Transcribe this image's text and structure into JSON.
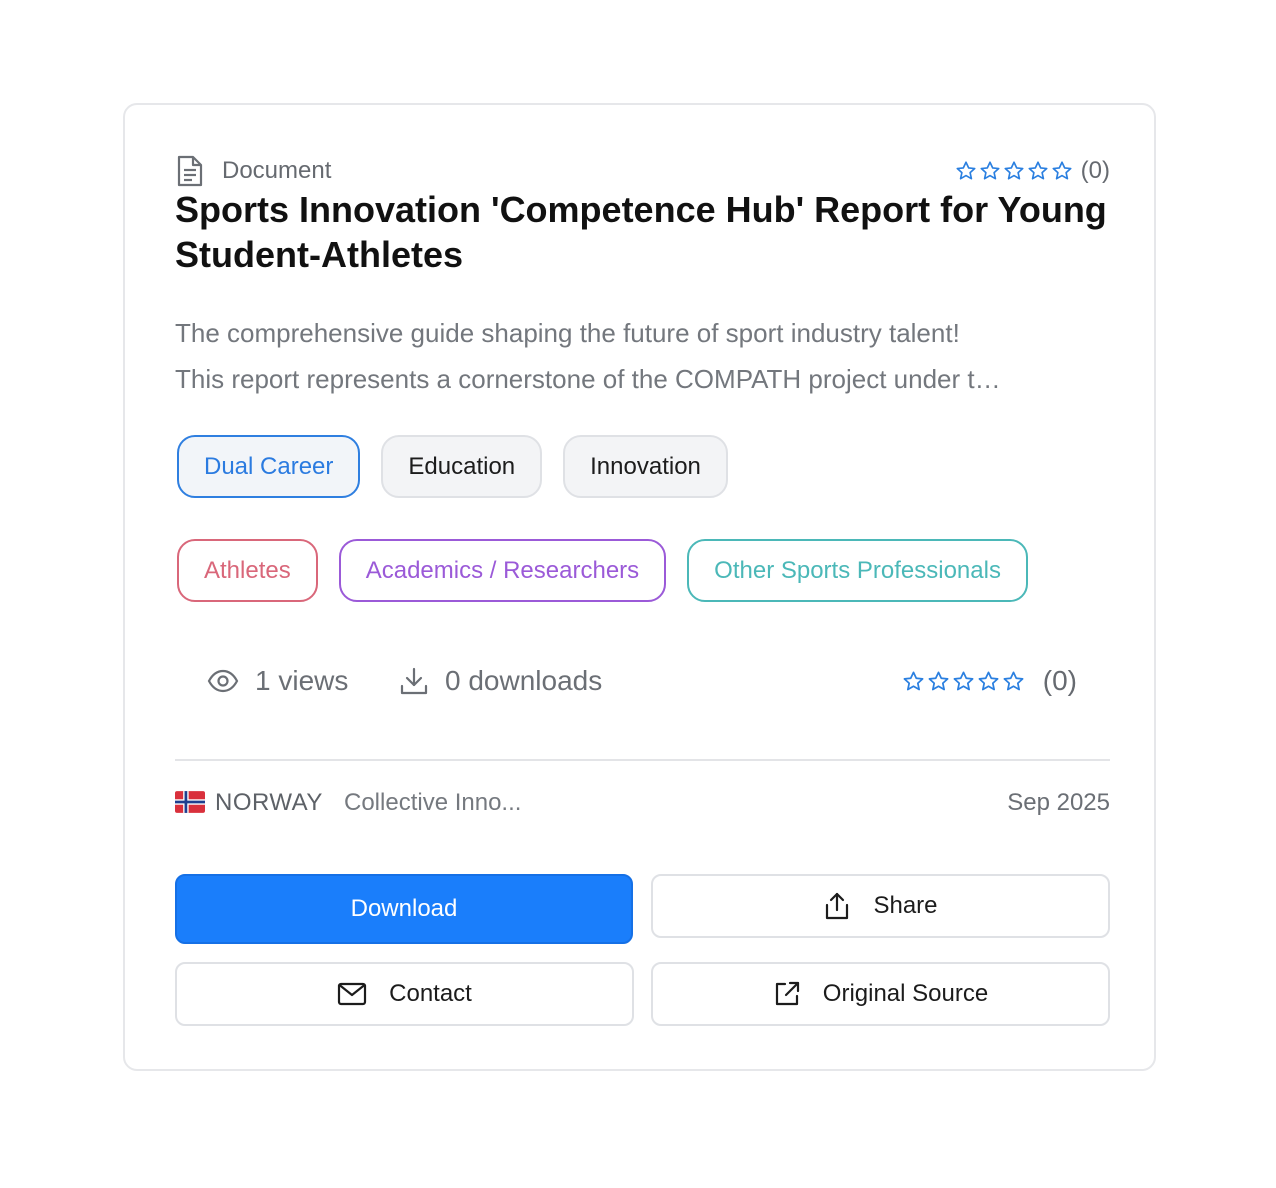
{
  "resource": {
    "type_label": "Document",
    "rating_count_label": "(0)",
    "rating_stars": 0,
    "title": "Sports Innovation 'Competence Hub' Report for Young Student-Athletes",
    "description_line1": "The comprehensive guide shaping the future of sport industry talent!",
    "description_line2": "This report represents a cornerstone of the COMPATH project under t…"
  },
  "categories": [
    {
      "label": "Dual Career",
      "active": true
    },
    {
      "label": "Education",
      "active": false
    },
    {
      "label": "Innovation",
      "active": false
    }
  ],
  "audiences": [
    {
      "label": "Athletes",
      "color": "#d9677a"
    },
    {
      "label": "Academics / Researchers",
      "color": "#9b5ad8"
    },
    {
      "label": "Other Sports Professionals",
      "color": "#4bb8b8"
    }
  ],
  "stats": {
    "views_label": "1 views",
    "downloads_label": "0 downloads",
    "rating_count_label": "(0)"
  },
  "meta": {
    "country": "NORWAY",
    "organization": "Collective Inno...",
    "date": "Sep 2025"
  },
  "actions": {
    "download_label": "Download",
    "share_label": "Share",
    "contact_label": "Contact",
    "source_label": "Original Source"
  },
  "colors": {
    "accent": "#1a7efb",
    "star": "#2a7fe0"
  }
}
